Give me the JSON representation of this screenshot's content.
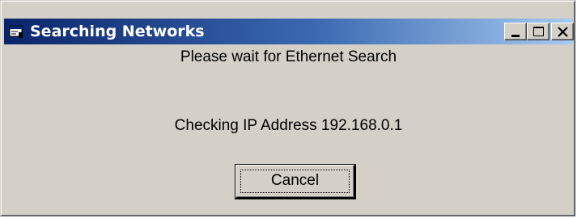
{
  "window": {
    "title": "Searching Networks",
    "icon": "application-window-icon",
    "caption_buttons": {
      "minimize_icon": "minimize-icon",
      "maximize_icon": "maximize-icon",
      "close_icon": "close-icon"
    }
  },
  "content": {
    "wait_message": "Please wait for Ethernet Search",
    "status_message": "Checking IP Address 192.168.0.1",
    "cancel_label": "Cancel"
  },
  "colors": {
    "titlebar_start": "#0a246a",
    "titlebar_end": "#a6caf0",
    "face": "#d4d0c8"
  }
}
